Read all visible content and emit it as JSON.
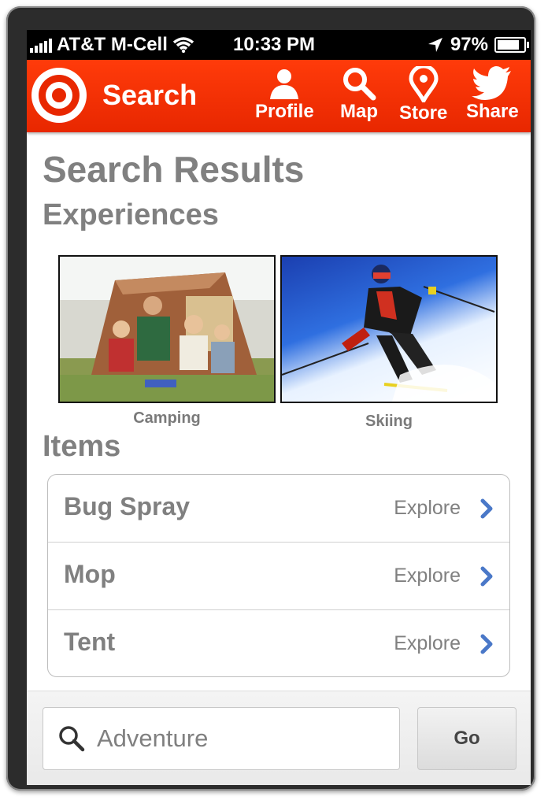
{
  "status_bar": {
    "carrier": "AT&T M-Cell",
    "time": "10:33 PM",
    "battery": "97%",
    "battery_level": 0.97
  },
  "header": {
    "title": "Search",
    "nav": [
      {
        "label": "Profile",
        "icon": "profile-icon"
      },
      {
        "label": "Map",
        "icon": "search-icon"
      },
      {
        "label": "Store",
        "icon": "location-pin-icon"
      },
      {
        "label": "Share",
        "icon": "twitter-bird-icon"
      }
    ],
    "brand_color": "#e82700"
  },
  "page": {
    "title": "Search Results",
    "experiences_heading": "Experiences",
    "items_heading": "Items"
  },
  "experiences": [
    {
      "caption": "Camping"
    },
    {
      "caption": "Skiing"
    }
  ],
  "items": [
    {
      "name": "Bug Spray",
      "action": "Explore"
    },
    {
      "name": "Mop",
      "action": "Explore"
    },
    {
      "name": "Tent",
      "action": "Explore"
    }
  ],
  "search": {
    "value": "Adventure",
    "button_label": "Go"
  },
  "colors": {
    "accent_chevron": "#4a78c8",
    "heading_text": "#808080"
  }
}
